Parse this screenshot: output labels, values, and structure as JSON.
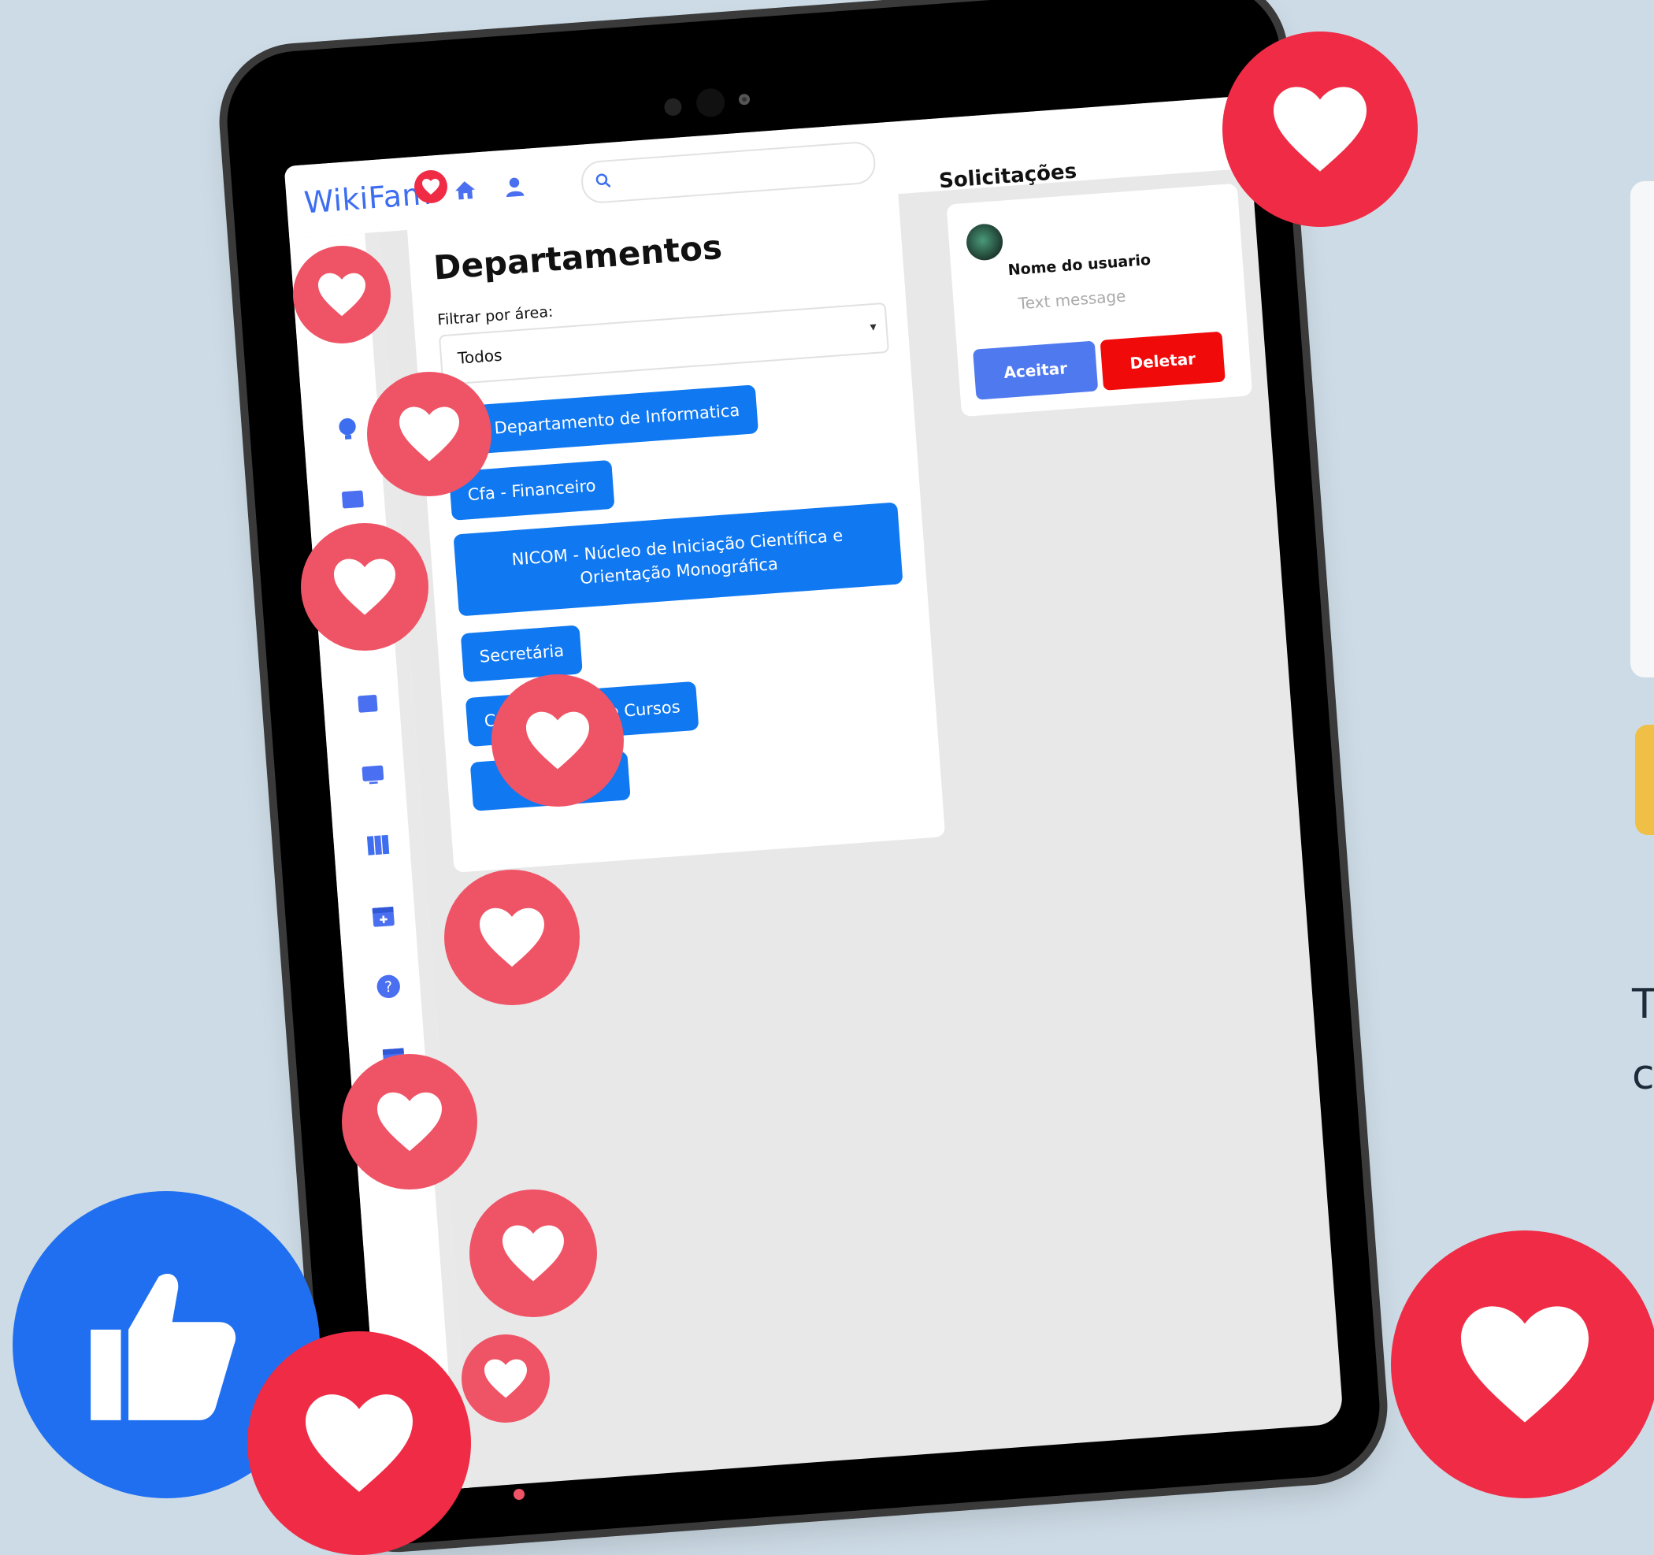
{
  "app": {
    "logo": "WikiFam",
    "search_placeholder": ""
  },
  "departments": {
    "title": "Departamentos",
    "filter_label": "Filtrar por área:",
    "filter_value": "Todos",
    "items": [
      {
        "label": "TI - Departamento de Informatica"
      },
      {
        "label": "Cfa - Financeiro"
      },
      {
        "label": "NICOM - Núcleo de Iniciação Científica e Orientação Monográfica"
      },
      {
        "label": "Secretária"
      },
      {
        "label": "Coordenação de Cursos"
      },
      {
        "label": "o"
      }
    ]
  },
  "requests": {
    "title": "Solicitações",
    "user_name": "Nome do usuario",
    "message": "Text message",
    "accept_label": "Aceitar",
    "delete_label": "Deletar"
  },
  "background_text": {
    "line1": "T",
    "line2": "c"
  },
  "colors": {
    "background": "#cddbe6",
    "accent_blue": "#1078f0",
    "logo_blue": "#3d6ef0",
    "accept": "#4f79ef",
    "delete": "#f10a0a",
    "heart_red": "#ef2b45",
    "heart_soft": "#ef5466",
    "like_blue": "#1f6ff0"
  },
  "icons": [
    "home-icon",
    "user-icon",
    "search-icon",
    "heart-icon",
    "like-icon",
    "calendar-icon",
    "help-icon",
    "book-icon",
    "monitor-icon"
  ]
}
